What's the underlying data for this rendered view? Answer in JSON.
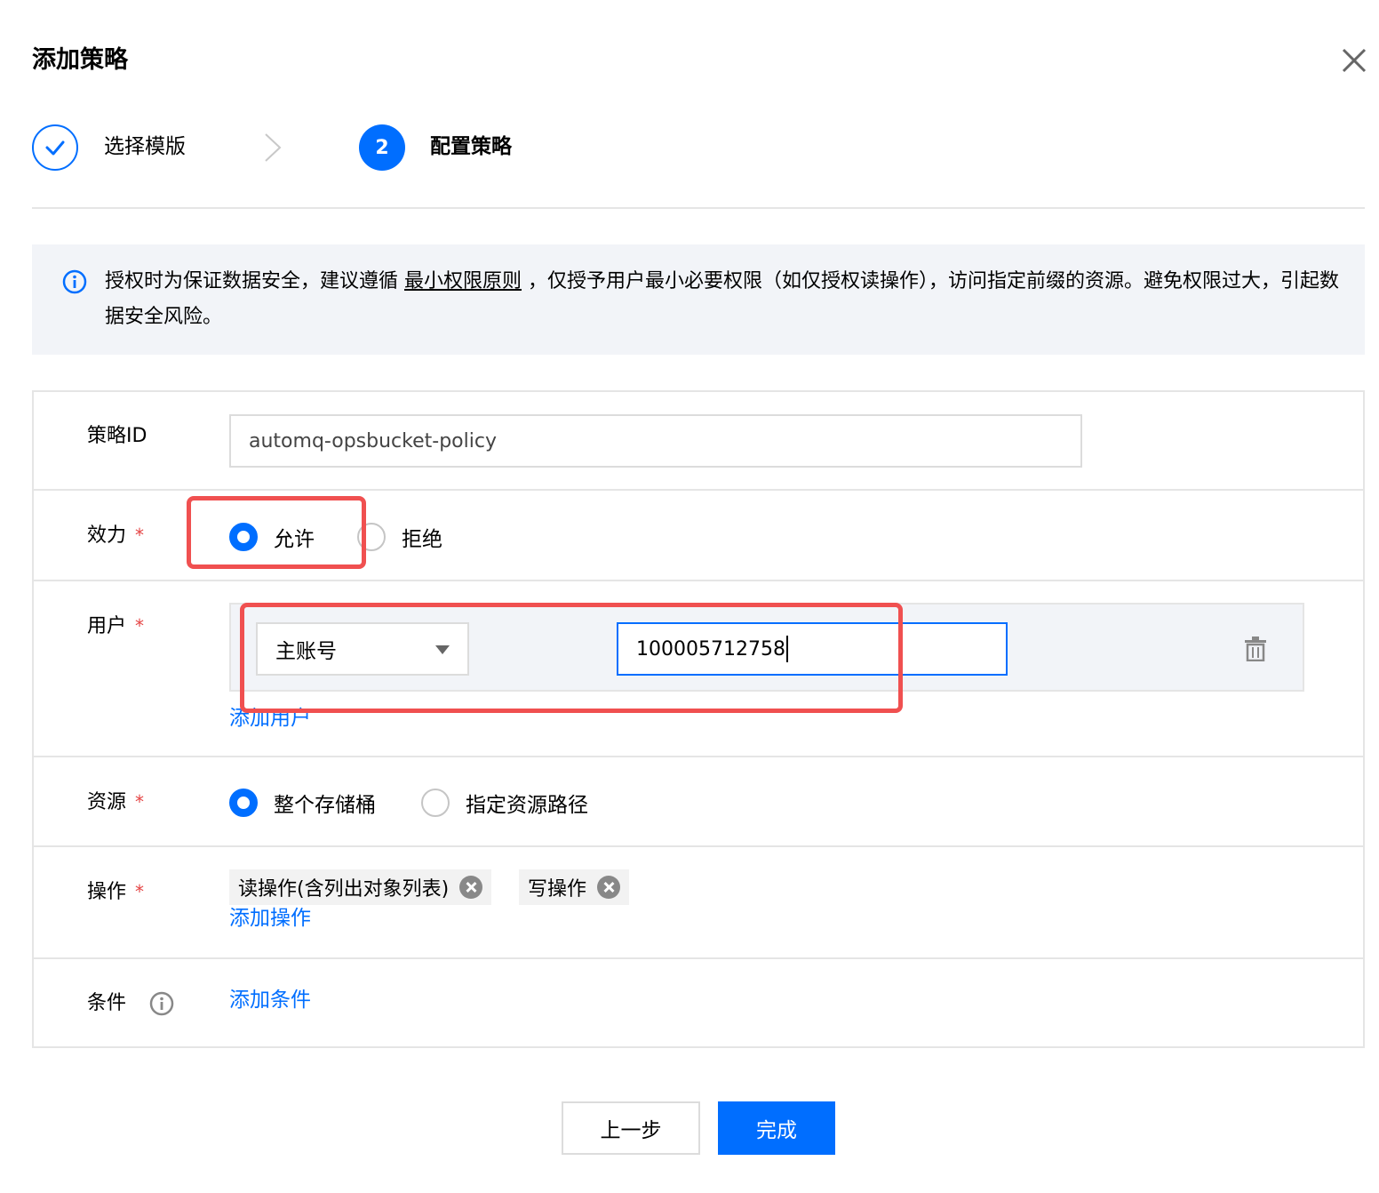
{
  "dialog": {
    "title": "添加策略",
    "close_icon": "close-icon"
  },
  "steps": [
    {
      "index": "1",
      "label": "选择模版",
      "state": "done"
    },
    {
      "index": "2",
      "label": "配置策略",
      "state": "active"
    }
  ],
  "notice": {
    "before_link": "授权时为保证数据安全，建议遵循 ",
    "link": "最小权限原则",
    "after_link": " ，仅授予用户最小必要权限（如仅授权读操作），访问指定前缀的资源。避免权限过大，引起数据安全风险。"
  },
  "form": {
    "policy_id": {
      "label": "策略ID",
      "value": "automq-opsbucket-policy"
    },
    "effect": {
      "label": "效力",
      "required_mark": "*",
      "options": [
        "允许",
        "拒绝"
      ],
      "selected": "允许"
    },
    "user": {
      "label": "用户",
      "required_mark": "*",
      "account_type": "主账号",
      "account_id": "100005712758",
      "add_link": "添加用户"
    },
    "resource": {
      "label": "资源",
      "required_mark": "*",
      "options": [
        "整个存储桶",
        "指定资源路径"
      ],
      "selected": "整个存储桶"
    },
    "action": {
      "label": "操作",
      "required_mark": "*",
      "tags": [
        "读操作(含列出对象列表)",
        "写操作"
      ],
      "add_link": "添加操作"
    },
    "condition": {
      "label": "条件",
      "add_link": "添加条件"
    }
  },
  "footer": {
    "prev_label": "上一步",
    "done_label": "完成"
  },
  "colors": {
    "primary": "#006eff",
    "highlight": "#f05050",
    "required": "#e54545",
    "notice_bg": "#f2f4f8"
  }
}
